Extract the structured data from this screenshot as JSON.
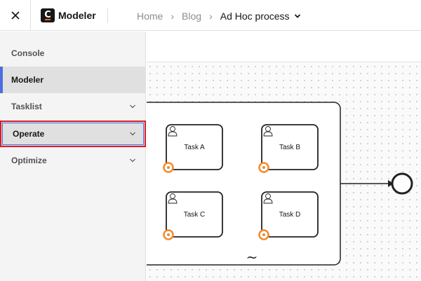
{
  "header": {
    "app_name": "Modeler",
    "breadcrumb": [
      {
        "label": "Home"
      },
      {
        "label": "Blog"
      },
      {
        "label": "Ad Hoc process"
      }
    ],
    "separator": "›"
  },
  "sidebar": {
    "items": [
      {
        "label": "Console",
        "has_chevron": false
      },
      {
        "label": "Modeler",
        "has_chevron": false,
        "active": true
      },
      {
        "label": "Tasklist",
        "has_chevron": true
      },
      {
        "label": "Operate",
        "has_chevron": true,
        "highlighted": true
      },
      {
        "label": "Optimize",
        "has_chevron": true
      }
    ]
  },
  "diagram": {
    "subprocess_marker": "~",
    "tasks": [
      {
        "label": "Task A",
        "icon": "user-task-icon",
        "boundary_event": "timer-icon"
      },
      {
        "label": "Task B",
        "icon": "user-task-icon",
        "boundary_event": "timer-icon"
      },
      {
        "label": "Task C",
        "icon": "user-task-icon",
        "boundary_event": "timer-icon"
      },
      {
        "label": "Task D",
        "icon": "user-task-icon",
        "boundary_event": "timer-icon"
      }
    ],
    "end_event": "end-event"
  },
  "colors": {
    "accent_blue": "#4a6ee0",
    "highlight_red": "#da1e28",
    "timer_orange": "#f28a2e",
    "logo_orange": "#fc5d0d"
  }
}
